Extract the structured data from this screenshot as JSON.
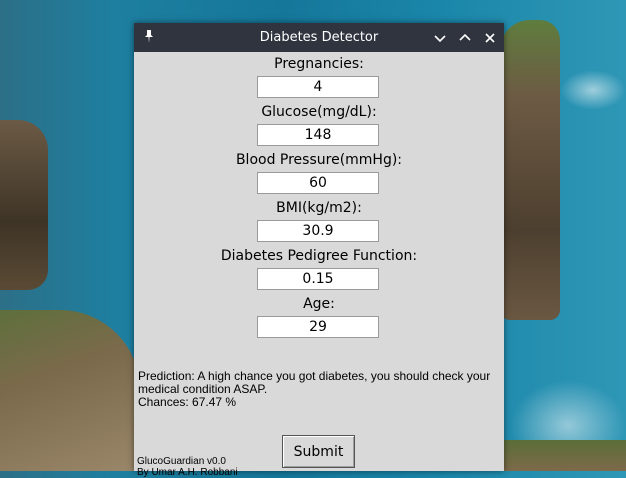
{
  "window": {
    "title": "Diabetes Detector"
  },
  "form": {
    "fields": [
      {
        "label": "Pregnancies:",
        "value": "4"
      },
      {
        "label": "Glucose(mg/dL):",
        "value": "148"
      },
      {
        "label": "Blood Pressure(mmHg):",
        "value": "60"
      },
      {
        "label": "BMI(kg/m2):",
        "value": "30.9"
      },
      {
        "label": "Diabetes Pedigree Function:",
        "value": "0.15"
      },
      {
        "label": "Age:",
        "value": "29"
      }
    ],
    "submit_label": "Submit"
  },
  "result": {
    "prediction": "Prediction: A high chance you got diabetes, you should check your medical condition ASAP.",
    "chances": "Chances: 67.47 %"
  },
  "footer": {
    "app_version": "GlucoGuardian v0.0",
    "author": "By Umar A.H. Robbani"
  },
  "colors": {
    "titlebar": "#2f343f",
    "window_bg": "#d9d9d9"
  },
  "icons": [
    "pin-icon",
    "minimize-icon",
    "maximize-icon",
    "close-icon"
  ]
}
